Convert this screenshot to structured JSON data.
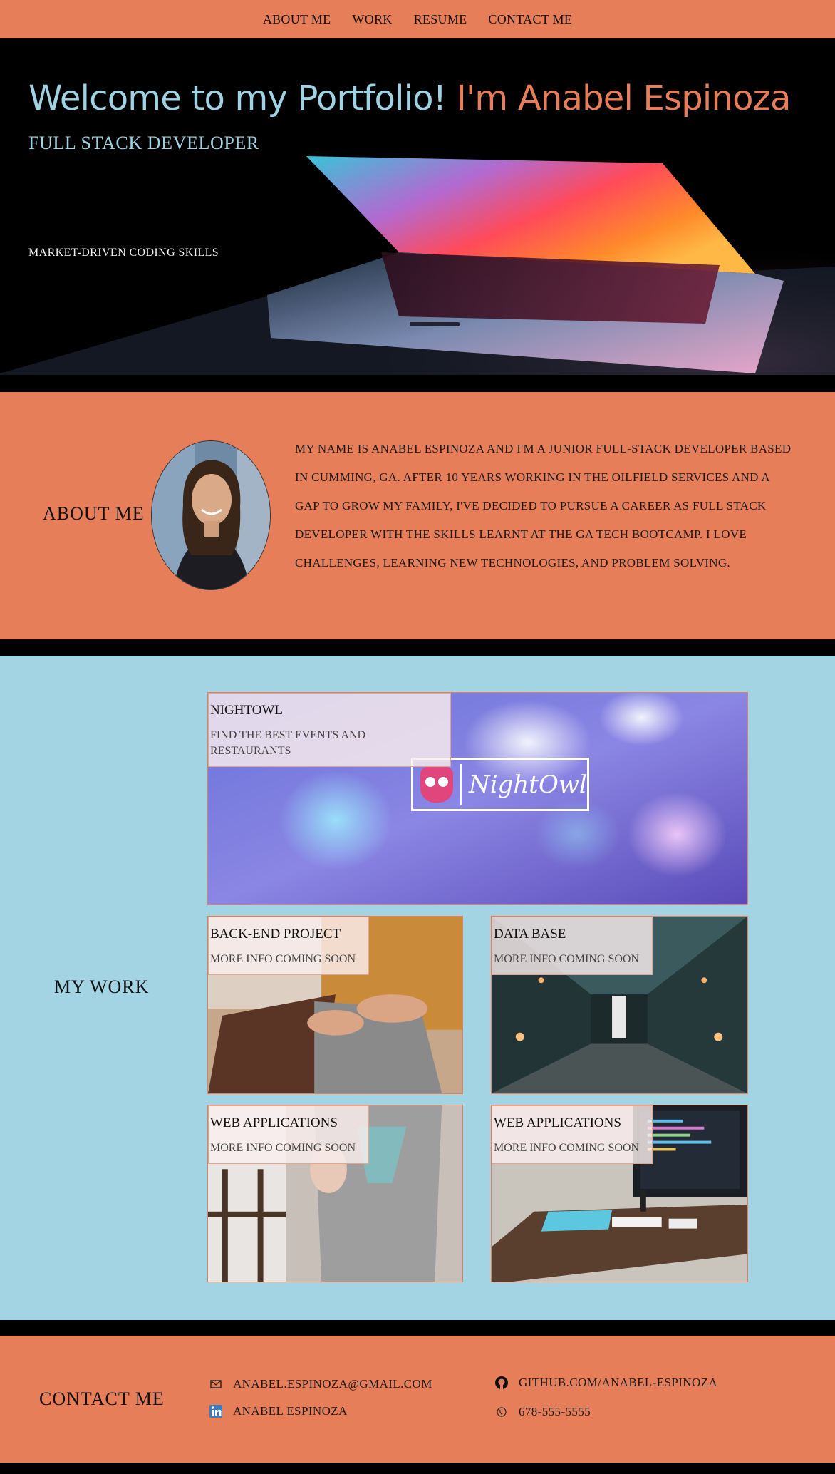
{
  "nav": {
    "items": [
      "ABOUT ME",
      "WORK",
      "RESUME",
      "CONTACT ME"
    ]
  },
  "hero": {
    "title_part1": "Welcome to my Portfolio!",
    "title_part2": "I'm Anabel Espinoza",
    "subtitle": "FULL STACK DEVELOPER",
    "tagline": "MARKET-DRIVEN CODING SKILLS"
  },
  "about": {
    "heading": "ABOUT ME",
    "bio": "MY NAME IS ANABEL ESPINOZA AND I'M A JUNIOR FULL-STACK DEVELOPER BASED IN CUMMING, GA. AFTER 10 YEARS WORKING IN THE OILFIELD SERVICES AND A GAP TO GROW MY FAMILY, I'VE DECIDED TO PURSUE A CAREER AS FULL STACK DEVELOPER WITH THE SKILLS LEARNT AT THE GA TECH BOOTCAMP. I LOVE CHALLENGES, LEARNING NEW TECHNOLOGIES, AND PROBLEM SOLVING."
  },
  "work": {
    "heading": "MY WORK",
    "projects": [
      {
        "title": "NIGHTOWL",
        "desc": "FIND THE BEST EVENTS AND RESTAURANTS",
        "logo_text": "NightOwl"
      },
      {
        "title": "BACK-END PROJECT",
        "desc": "MORE INFO COMING SOON"
      },
      {
        "title": "DATA BASE",
        "desc": "MORE INFO COMING SOON"
      },
      {
        "title": "WEB APPLICATIONS",
        "desc": "MORE INFO COMING SOON"
      },
      {
        "title": "WEB APPLICATIONS",
        "desc": "MORE INFO COMING SOON"
      }
    ]
  },
  "contact": {
    "heading": "CONTACT ME",
    "email": "ANABEL.ESPINOZA@GMAIL.COM",
    "github": "GITHUB.COM/ANABEL-ESPINOZA",
    "linkedin": "ANABEL ESPINOZA",
    "phone": "678-555-5555"
  },
  "colors": {
    "accent": "#e67e59",
    "light_blue": "#a2d4e4",
    "title_blue": "#9fd3e4"
  }
}
